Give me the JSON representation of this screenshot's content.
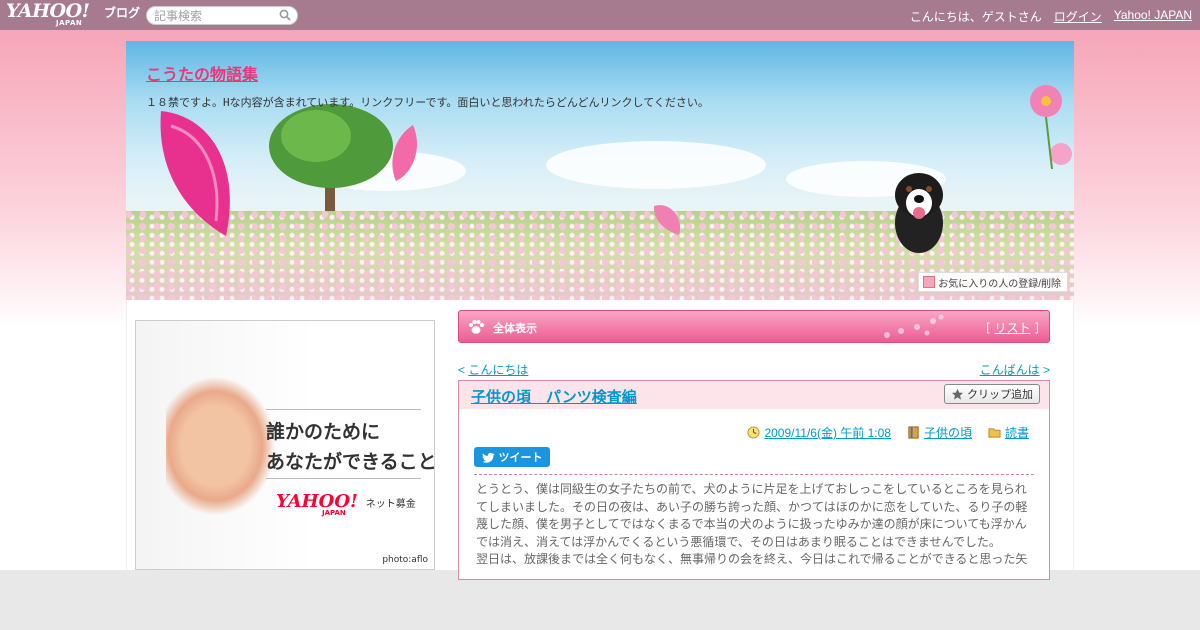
{
  "topbar": {
    "logo_text": "YAHOO!",
    "logo_sub": "JAPAN",
    "logo_blog": "ブログ",
    "search_placeholder": "記事検索",
    "greeting": "こんにちは、ゲストさん",
    "login": "ログイン",
    "yahoo_japan": "Yahoo! JAPAN"
  },
  "header": {
    "blog_title": "こうたの物語集",
    "description": "１８禁ですよ。Hな内容が含まれています。リンクフリーです。面白いと思われたらどんどんリンクしてください。",
    "favorite_button": "お気に入りの人の登録/削除"
  },
  "ad": {
    "line1": "誰かのために",
    "line2": "あなたができること",
    "logo_text": "YAHOO!",
    "logo_sub": "JAPAN",
    "net_label": "ネット募金",
    "credit": "photo:aflo"
  },
  "section": {
    "title": "全体表示",
    "list_link": "リスト"
  },
  "nav": {
    "prev": "こんにちは",
    "next": "こんばんは"
  },
  "article": {
    "title": "子供の頃　パンツ検査編",
    "clip_button": "クリップ追加",
    "date": "2009/11/6(金) 午前 1:08",
    "category": "子供の頃",
    "tag": "読書",
    "tweet_button": "ツイート",
    "body": "とうとう、僕は同級生の女子たちの前で、犬のように片足を上げておしっこをしているところを見られてしまいました。その日の夜は、あい子の勝ち誇った顔、かつてはほのかに恋をしていた、るり子の軽蔑した顔、僕を男子としてではなくまるで本当の犬のように扱ったゆみか達の顔が床についても浮かんでは消え、消えては浮かんでくるという悪循環で、その日はあまり眠ることはできませんでした。\n翌日は、放課後までは全く何もなく、無事帰りの会を終え、今日はこれで帰ることができると思った矢"
  },
  "colors": {
    "topbar": "#a67b8f",
    "accent_pink": "#e33b78",
    "link": "#0099cc"
  }
}
